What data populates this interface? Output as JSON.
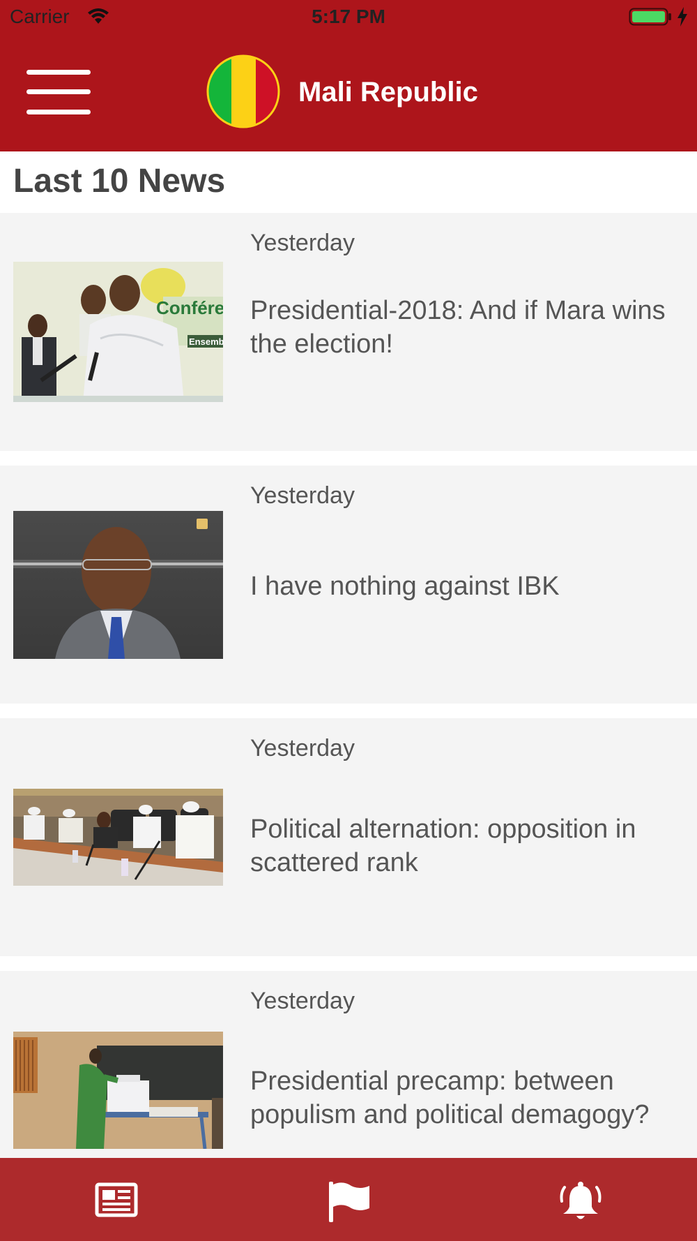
{
  "status_bar": {
    "carrier": "Carrier",
    "time": "5:17 PM",
    "battery_color": "#4cd964"
  },
  "header": {
    "title": "Mali Republic",
    "background_color": "#ad151b",
    "logo": "mali-flag-icon"
  },
  "section": {
    "title": "Last 10 News"
  },
  "news": [
    {
      "date": "Yesterday",
      "title": "Presidential-2018: And if Mara wins the election!"
    },
    {
      "date": "Yesterday",
      "title": "I have nothing against IBK"
    },
    {
      "date": "Yesterday",
      "title": "Political alternation: opposition in scattered rank"
    },
    {
      "date": "Yesterday",
      "title": "Presidential precamp: between populism and political demagogy?"
    }
  ],
  "tab_bar": {
    "background_color": "#ad2a2c",
    "tabs": [
      {
        "icon": "newspaper-icon"
      },
      {
        "icon": "flag-icon"
      },
      {
        "icon": "bell-icon"
      }
    ]
  }
}
